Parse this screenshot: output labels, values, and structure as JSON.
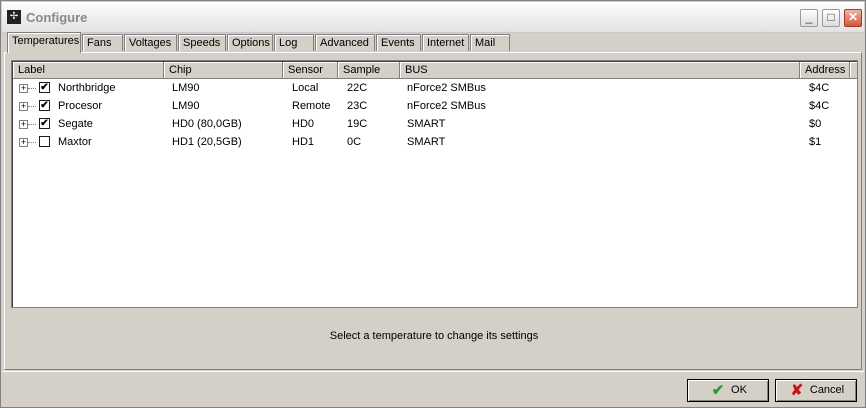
{
  "window": {
    "title": "Configure",
    "minimize_glyph": "_",
    "maximize_glyph": "□",
    "close_glyph": "✕"
  },
  "tabs": [
    {
      "label": "Temperatures",
      "active": true
    },
    {
      "label": "Fans"
    },
    {
      "label": "Voltages"
    },
    {
      "label": "Speeds"
    },
    {
      "label": "Options"
    },
    {
      "label": "Log"
    },
    {
      "label": "Advanced"
    },
    {
      "label": "Events"
    },
    {
      "label": "Internet"
    },
    {
      "label": "Mail"
    }
  ],
  "table": {
    "columns": [
      "Label",
      "Chip",
      "Sensor",
      "Sample",
      "BUS",
      "Address"
    ],
    "rows": [
      {
        "checked": true,
        "label": "Northbridge",
        "chip": "LM90",
        "sensor": "Local",
        "sample": "22C",
        "bus": "nForce2 SMBus",
        "address": "$4C"
      },
      {
        "checked": true,
        "label": "Procesor",
        "chip": "LM90",
        "sensor": "Remote",
        "sample": "23C",
        "bus": "nForce2 SMBus",
        "address": "$4C"
      },
      {
        "checked": true,
        "label": "Segate",
        "chip": "HD0 (80,0GB)",
        "sensor": "HD0",
        "sample": "19C",
        "bus": "SMART",
        "address": "$0"
      },
      {
        "checked": false,
        "label": "Maxtor",
        "chip": "HD1 (20,5GB)",
        "sensor": "HD1",
        "sample": "0C",
        "bus": "SMART",
        "address": "$1"
      }
    ]
  },
  "status_text": "Select a temperature to change its settings",
  "buttons": {
    "ok_label": "OK",
    "cancel_label": "Cancel"
  },
  "colors": {
    "ok_icon": "#2c9a2c",
    "cancel_icon": "#c01818"
  }
}
